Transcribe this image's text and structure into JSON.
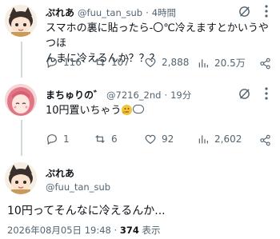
{
  "tweet1": {
    "name": "ぷれあ",
    "handle": "@fuu_tan_sub",
    "sep": "·",
    "time": "4時間",
    "text_line1": "スマホの裏に貼ったら-〇℃冷えますとかいうやつほ",
    "text_line2": "んまに冷えるんか？？？",
    "replies": "116",
    "retweets": "107",
    "likes": "2,888",
    "views": "20.5万"
  },
  "tweet2": {
    "name": "まちゅりの゛",
    "handle": "@7216_2nd",
    "sep": "·",
    "time": "19分",
    "text": "10円置いちゃう",
    "replies": "1",
    "retweets": "6",
    "likes": "92",
    "views": "2,602"
  },
  "main_tweet": {
    "name": "ぷれあ",
    "handle": "@fuu_tan_sub",
    "text": "10円ってそんなに冷えるんか...",
    "timestamp": "2026年08月05日 19:48",
    "dot": "·",
    "views_count": "374",
    "views_label": "表示"
  },
  "icons": [
    "avatar-cat-girl",
    "avatar-pink-hair",
    "mute-icon",
    "more-icon",
    "reply-icon",
    "retweet-icon",
    "like-icon",
    "views-icon",
    "share-icon",
    "thinking-emoji",
    "speech-bubble-emoji"
  ]
}
